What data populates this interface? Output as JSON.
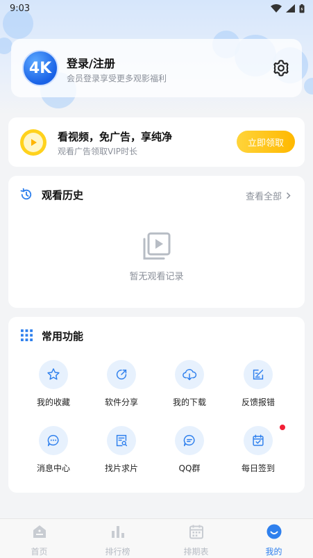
{
  "status_bar": {
    "time": "9:03"
  },
  "profile": {
    "avatar_text": "4K",
    "title": "登录/注册",
    "subtitle": "会员登录享受更多观影福利",
    "settings_icon": "gear-icon"
  },
  "ad_banner": {
    "title": "看视频，免广告，享纯净",
    "subtitle": "观看广告领取VIP时长",
    "button_label": "立即领取"
  },
  "history": {
    "title": "观看历史",
    "view_all": "查看全部",
    "empty_text": "暂无观看记录"
  },
  "functions": {
    "title": "常用功能",
    "items": [
      {
        "label": "我的收藏",
        "icon": "star-icon"
      },
      {
        "label": "软件分享",
        "icon": "share-icon"
      },
      {
        "label": "我的下载",
        "icon": "cloud-download-icon"
      },
      {
        "label": "反馈报错",
        "icon": "edit-icon"
      },
      {
        "label": "消息中心",
        "icon": "chat-bubble-icon"
      },
      {
        "label": "找片求片",
        "icon": "search-doc-icon"
      },
      {
        "label": "QQ群",
        "icon": "group-chat-icon"
      },
      {
        "label": "每日签到",
        "icon": "calendar-check-icon"
      }
    ]
  },
  "bottom_nav": {
    "items": [
      {
        "label": "首页",
        "icon": "home-icon"
      },
      {
        "label": "排行榜",
        "icon": "bar-chart-icon"
      },
      {
        "label": "排期表",
        "icon": "calendar-icon"
      },
      {
        "label": "我的",
        "icon": "smile-icon"
      }
    ],
    "active_index": 3
  },
  "colors": {
    "accent": "#2f80ed",
    "claim_button": "#ffc21a",
    "notification_dot": "#f21f35"
  }
}
